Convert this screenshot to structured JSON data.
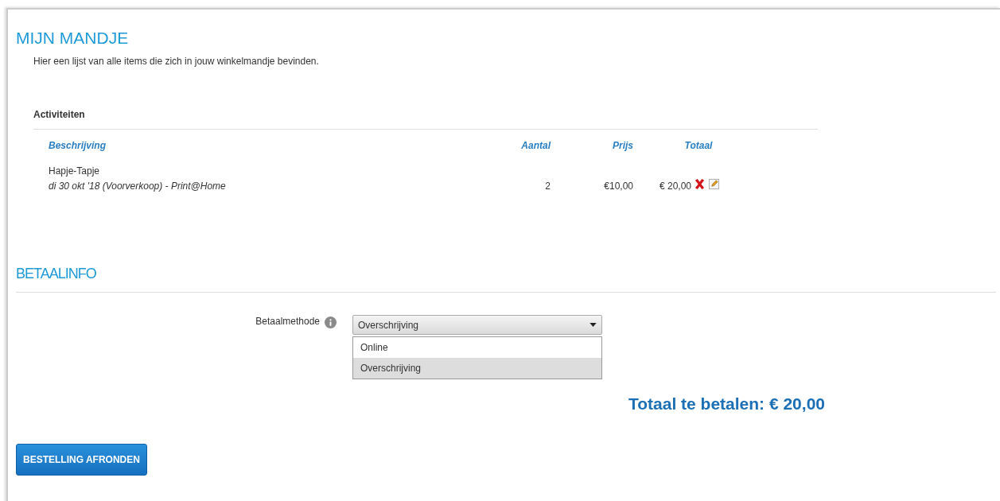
{
  "title": "MIJN MANDJE",
  "intro": "Hier een lijst van alle items die zich in jouw winkelmandje bevinden.",
  "section": "Activiteiten",
  "table": {
    "columns": [
      "Beschrijving",
      "Aantal",
      "Prijs",
      "Totaal"
    ],
    "rows": [
      {
        "name": "Hapje-Tapje",
        "detail": "di 30 okt '18 (Voorverkoop) - Print@Home",
        "quantity": "2",
        "price": "€10,00",
        "total": "€ 20,00"
      }
    ]
  },
  "payment": {
    "heading": "BETAALINFO",
    "label": "Betaalmethode",
    "value": "Overschrijving",
    "options": [
      {
        "label": "Online",
        "selected": false
      },
      {
        "label": "Overschrijving",
        "selected": true
      }
    ]
  },
  "total": "Totaal te betalen: € 20,00",
  "submit": "BESTELLING AFRONDEN"
}
